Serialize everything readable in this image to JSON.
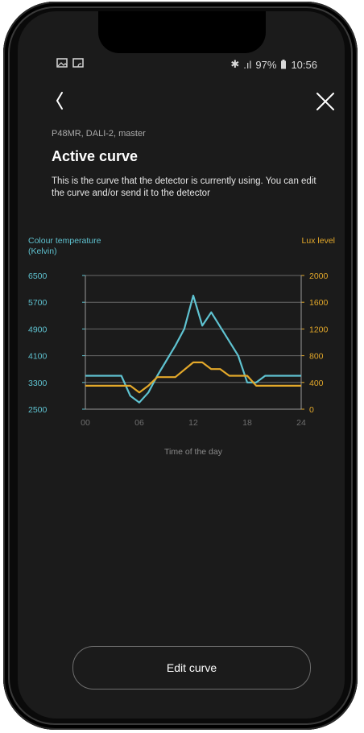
{
  "status_bar": {
    "left_icons": [
      "image-icon",
      "cast-icon"
    ],
    "bluetooth": "✱",
    "signal": ".ıl",
    "battery": "97%",
    "time": "10:56"
  },
  "nav": {
    "back_icon": "chevron-left-icon",
    "close_icon": "close-icon"
  },
  "device_info": "P48MR, DALI-2, master",
  "title": "Active curve",
  "description": "This is the curve that the detector is currently using. You can edit the curve and/or send it to the detector",
  "edit_button_label": "Edit curve",
  "colors": {
    "background": "#1b1b1b",
    "cyan": "#5fc3d1",
    "gold": "#e3a82a",
    "grid": "#6a6a6a"
  },
  "chart_data": {
    "type": "line",
    "xlabel": "Time of the day",
    "x_ticks": [
      "00",
      "06",
      "12",
      "18",
      "24"
    ],
    "xlim": [
      0,
      24
    ],
    "left_axis": {
      "label_line1": "Colour temperature",
      "label_line2": "(Kelvin)",
      "ticks": [
        "6500",
        "5700",
        "4900",
        "4100",
        "3300",
        "2500"
      ],
      "ylim": [
        2500,
        6500
      ]
    },
    "right_axis": {
      "label": "Lux level",
      "ticks": [
        "2000",
        "1600",
        "1200",
        "800",
        "400",
        "0"
      ],
      "ylim": [
        0,
        2000
      ]
    },
    "grid": true,
    "series": [
      {
        "axis": "left",
        "color": "#5fc3d1",
        "points": [
          [
            0,
            3500
          ],
          [
            4,
            3500
          ],
          [
            5,
            2900
          ],
          [
            6,
            2700
          ],
          [
            7,
            3000
          ],
          [
            8,
            3500
          ],
          [
            10,
            4400
          ],
          [
            11,
            4900
          ],
          [
            12,
            5900
          ],
          [
            13,
            5000
          ],
          [
            14,
            5400
          ],
          [
            17,
            4100
          ],
          [
            18,
            3300
          ],
          [
            19,
            3300
          ],
          [
            20,
            3500
          ],
          [
            24,
            3500
          ]
        ]
      },
      {
        "axis": "right",
        "color": "#e3a82a",
        "points": [
          [
            0,
            350
          ],
          [
            5,
            350
          ],
          [
            6,
            250
          ],
          [
            7,
            350
          ],
          [
            8,
            480
          ],
          [
            10,
            480
          ],
          [
            12,
            700
          ],
          [
            13,
            700
          ],
          [
            14,
            600
          ],
          [
            15,
            600
          ],
          [
            16,
            500
          ],
          [
            18,
            500
          ],
          [
            19,
            350
          ],
          [
            24,
            350
          ]
        ]
      }
    ]
  }
}
